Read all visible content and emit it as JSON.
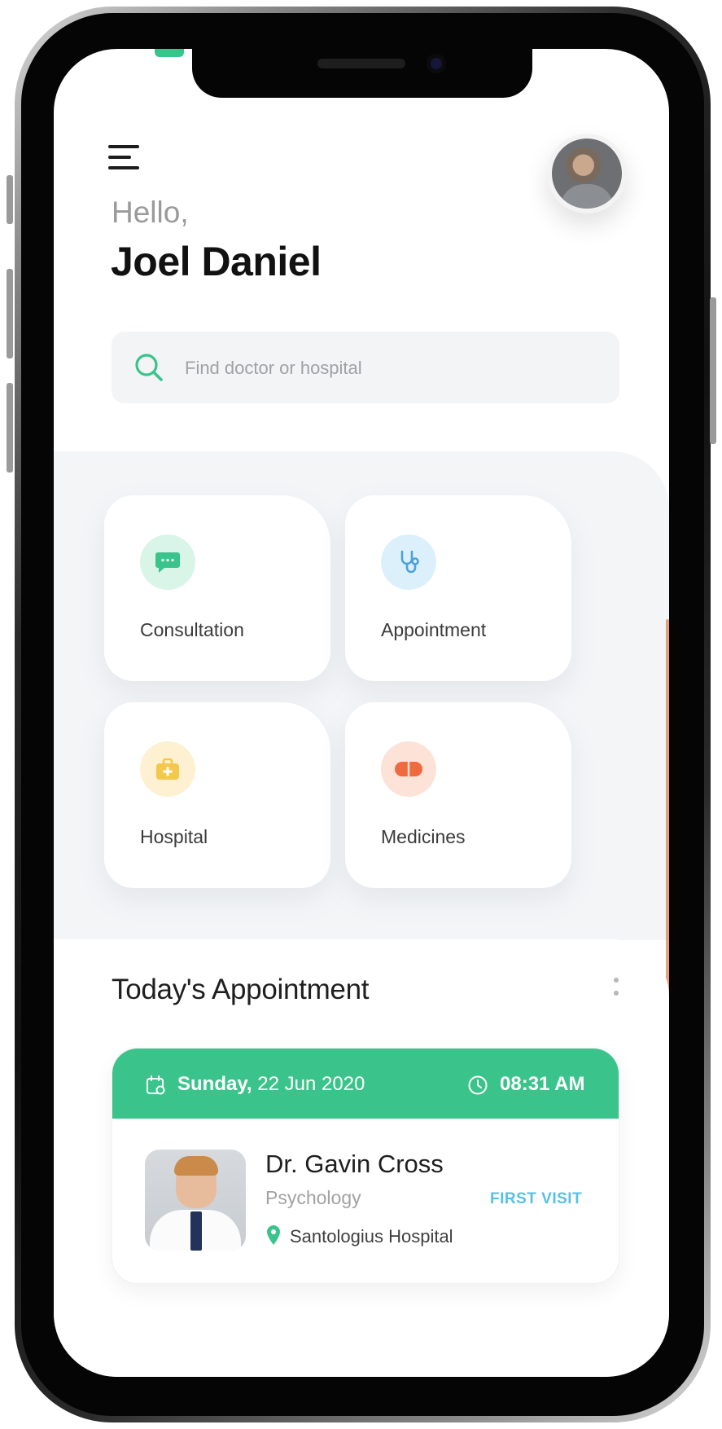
{
  "greeting": "Hello,",
  "user": {
    "name": "Joel Daniel"
  },
  "search": {
    "placeholder": "Find doctor or hospital"
  },
  "services": [
    {
      "label": "Consultation",
      "icon": "chat-bubble-icon",
      "color": "#3ac48b",
      "bg": "#d8f5e8"
    },
    {
      "label": "Appointment",
      "icon": "stethoscope-icon",
      "color": "#4aa3d9",
      "bg": "#dcf0fb"
    },
    {
      "label": "Hospital",
      "icon": "medical-case-icon",
      "color": "#f2c94c",
      "bg": "#fdf1d2"
    },
    {
      "label": "Medicines",
      "icon": "pill-icon",
      "color": "#ef6a3e",
      "bg": "#fde2d8"
    }
  ],
  "appointments": {
    "title": "Today's Appointment",
    "item": {
      "day": "Sunday,",
      "date": "22 Jun 2020",
      "time": "08:31 AM",
      "doctor": "Dr. Gavin Cross",
      "specialty": "Psychology",
      "visit_type": "FIRST VISIT",
      "hospital": "Santologius Hospital"
    }
  },
  "colors": {
    "accent": "#3ac48b",
    "link": "#56c1e6"
  }
}
